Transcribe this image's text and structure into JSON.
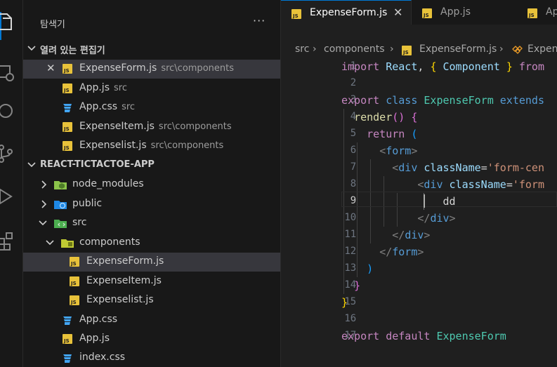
{
  "sidebar": {
    "title": "탐색기",
    "more": "···",
    "open_editors": {
      "header": "열려 있는 편집기",
      "items": [
        {
          "name": "ExpenseForm.js",
          "desc": "src\\components",
          "icon": "js-file-icon"
        },
        {
          "name": "App.js",
          "desc": "src",
          "icon": "js-file-icon"
        },
        {
          "name": "App.css",
          "desc": "src",
          "icon": "css-file-icon"
        },
        {
          "name": "ExpenseItem.js",
          "desc": "src\\components",
          "icon": "js-file-icon"
        },
        {
          "name": "Expenselist.js",
          "desc": "src\\components",
          "icon": "js-file-icon"
        }
      ]
    },
    "project": {
      "header": "REACT-TICTACTOE-APP",
      "tree": [
        {
          "name": "node_modules",
          "icon": "node-folder-icon"
        },
        {
          "name": "public",
          "icon": "public-folder-icon"
        },
        {
          "name": "src",
          "icon": "src-folder-icon"
        },
        {
          "name": "components",
          "icon": "components-folder-icon"
        },
        {
          "name": "ExpenseForm.js",
          "icon": "js-file-icon"
        },
        {
          "name": "ExpenseItem.js",
          "icon": "js-file-icon"
        },
        {
          "name": "Expenselist.js",
          "icon": "js-file-icon"
        },
        {
          "name": "App.css",
          "icon": "css-file-icon"
        },
        {
          "name": "App.js",
          "icon": "js-file-icon"
        },
        {
          "name": "index.css",
          "icon": "css-file-icon"
        }
      ]
    }
  },
  "editor": {
    "tabs": [
      {
        "label": "ExpenseForm.js",
        "active": true
      },
      {
        "label": "App.js",
        "active": false
      },
      {
        "label": "Ap",
        "active": false
      }
    ],
    "close_glyph": "✕",
    "breadcrumb": {
      "items": [
        "src",
        "components",
        "ExpenseForm.js",
        "Expen"
      ],
      "separator": "›"
    },
    "line_numbers": [
      "1",
      "2",
      "3",
      "4",
      "5",
      "6",
      "7",
      "8",
      "9",
      "10",
      "11",
      "12",
      "13",
      "14",
      "15",
      "16",
      "17"
    ],
    "current_line": "9",
    "code": {
      "l1": {
        "a": "import",
        "b": "React",
        "c": ",",
        "d": "{",
        "e": "Component",
        "f": "}",
        "g": "from"
      },
      "l3": {
        "a": "export",
        "b": "class",
        "c": "ExpenseForm",
        "d": "extends"
      },
      "l4": {
        "a": "render",
        "b": "()",
        "c": "{"
      },
      "l5": {
        "a": "return",
        "b": "("
      },
      "l6": {
        "a": "<",
        "b": "form",
        "c": ">"
      },
      "l7": {
        "a": "<",
        "b": "div",
        "c": "className",
        "d": "=",
        "e": "'form-cen"
      },
      "l8": {
        "a": "<",
        "b": "div",
        "c": "className",
        "d": "=",
        "e": "'form"
      },
      "l9": {
        "a": "dd"
      },
      "l10": {
        "a": "</",
        "b": "div",
        "c": ">"
      },
      "l11": {
        "a": "</",
        "b": "div",
        "c": ">"
      },
      "l12": {
        "a": "</",
        "b": "form",
        "c": ">"
      },
      "l13": {
        "a": ")"
      },
      "l14": {
        "a": "}"
      },
      "l15": {
        "a": "}"
      },
      "l17": {
        "a": "export",
        "b": "default",
        "c": "ExpenseForm"
      }
    }
  },
  "colors": {
    "accent": "#0078d4",
    "js_icon": "#e8c23a",
    "css_icon": "#42a5f5",
    "selection": "#37373d"
  }
}
